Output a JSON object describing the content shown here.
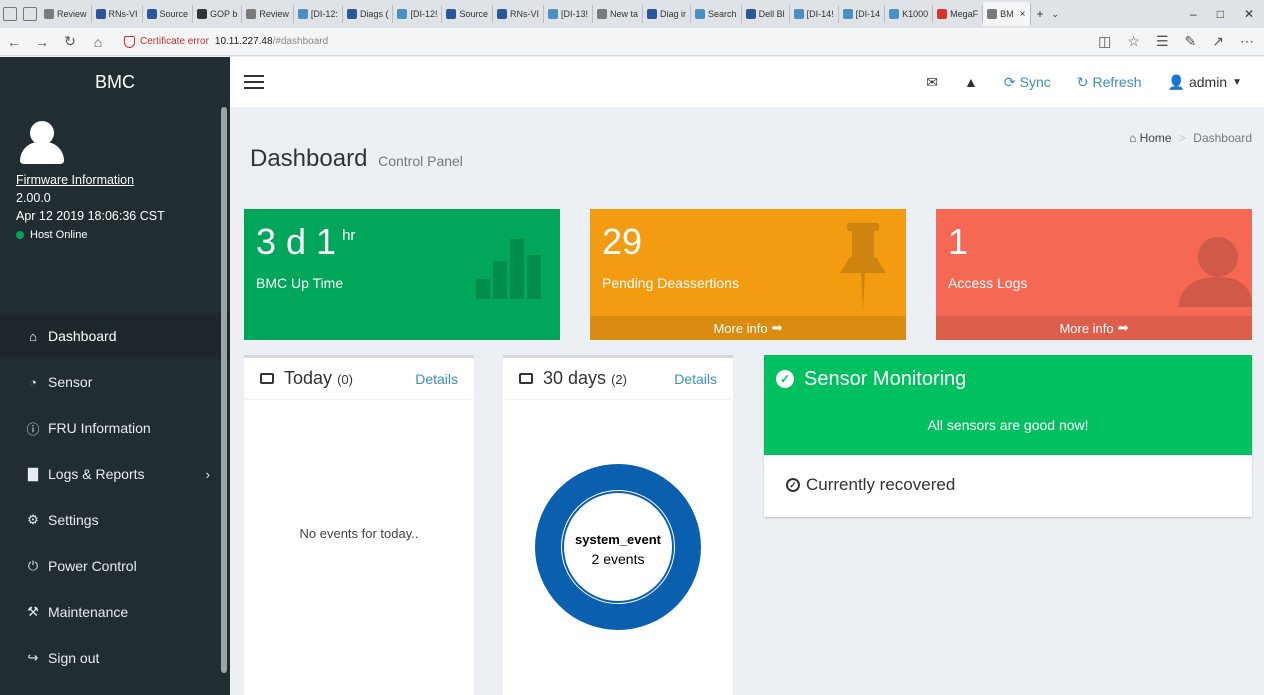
{
  "browser": {
    "tabs": [
      {
        "label": "Review",
        "color": "#7a7a7a"
      },
      {
        "label": "RNs-VI",
        "color": "#2b579a"
      },
      {
        "label": "Source",
        "color": "#2b579a"
      },
      {
        "label": "GOP b",
        "color": "#333333"
      },
      {
        "label": "Review",
        "color": "#7a7a7a"
      },
      {
        "label": "[DI-12:",
        "color": "#4a90c2"
      },
      {
        "label": "Diags (",
        "color": "#2b579a"
      },
      {
        "label": "[DI-12!",
        "color": "#4a90c2"
      },
      {
        "label": "Source",
        "color": "#2b579a"
      },
      {
        "label": "RNs-VI",
        "color": "#2b579a"
      },
      {
        "label": "[DI-13!",
        "color": "#4a90c2"
      },
      {
        "label": "New ta",
        "color": "#7a7a7a"
      },
      {
        "label": "Diag ir",
        "color": "#2b579a"
      },
      {
        "label": "Search",
        "color": "#4a90c2"
      },
      {
        "label": "Dell Bl",
        "color": "#2b579a"
      },
      {
        "label": "[DI-14!",
        "color": "#4a90c2"
      },
      {
        "label": "[DI-14",
        "color": "#4a90c2"
      },
      {
        "label": "K1000",
        "color": "#4a90c2"
      },
      {
        "label": "MegaF",
        "color": "#d9342b"
      },
      {
        "label": "BM",
        "color": "#7a7a7a",
        "active": true
      }
    ],
    "cert_error": "Certificate error",
    "url_host": "10.11.227.48",
    "url_fragment": "/#dashboard"
  },
  "sidebar": {
    "brand": "BMC",
    "firmware_link": "Firmware Information",
    "firmware_version": "2.00.0",
    "firmware_date": "Apr 12 2019 18:06:36 CST",
    "host_status": "Host Online",
    "items": [
      {
        "label": "Dashboard",
        "icon": "home-icon",
        "glyph": "⌂",
        "active": true
      },
      {
        "label": "Sensor",
        "icon": "dashboard-icon",
        "glyph": "◔"
      },
      {
        "label": "FRU Information",
        "icon": "info-icon",
        "glyph": "ⓘ"
      },
      {
        "label": "Logs & Reports",
        "icon": "bar-chart-icon",
        "glyph": "▇",
        "has_children": true
      },
      {
        "label": "Settings",
        "icon": "gear-icon",
        "glyph": "⚙"
      },
      {
        "label": "Power Control",
        "icon": "power-icon",
        "glyph": "⏻"
      },
      {
        "label": "Maintenance",
        "icon": "wrench-icon",
        "glyph": "⚒"
      },
      {
        "label": "Sign out",
        "icon": "sign-out-icon",
        "glyph": "↪"
      }
    ]
  },
  "topbar": {
    "sync": "Sync",
    "refresh": "Refresh",
    "user": "admin"
  },
  "page": {
    "title": "Dashboard",
    "subtitle": "Control Panel",
    "breadcrumb_home": "Home",
    "breadcrumb_current": "Dashboard"
  },
  "infoboxes": {
    "uptime_value": "3 d 1",
    "uptime_unit": "hr",
    "uptime_label": "BMC Up Time",
    "pending_value": "29",
    "pending_label": "Pending Deassertions",
    "pending_more": "More info",
    "access_value": "1",
    "access_label": "Access Logs",
    "access_more": "More info"
  },
  "events_today": {
    "title": "Today",
    "count": "(0)",
    "details": "Details",
    "empty": "No events for today.."
  },
  "events_30": {
    "title": "30 days",
    "count": "(2)",
    "details": "Details",
    "donut_label": "system_event",
    "donut_value": "2 events"
  },
  "sensor": {
    "title": "Sensor Monitoring",
    "message": "All sensors are good now!",
    "status": "Currently recovered"
  },
  "chart_data": {
    "type": "pie",
    "categories": [
      "system_event"
    ],
    "values": [
      2
    ]
  }
}
